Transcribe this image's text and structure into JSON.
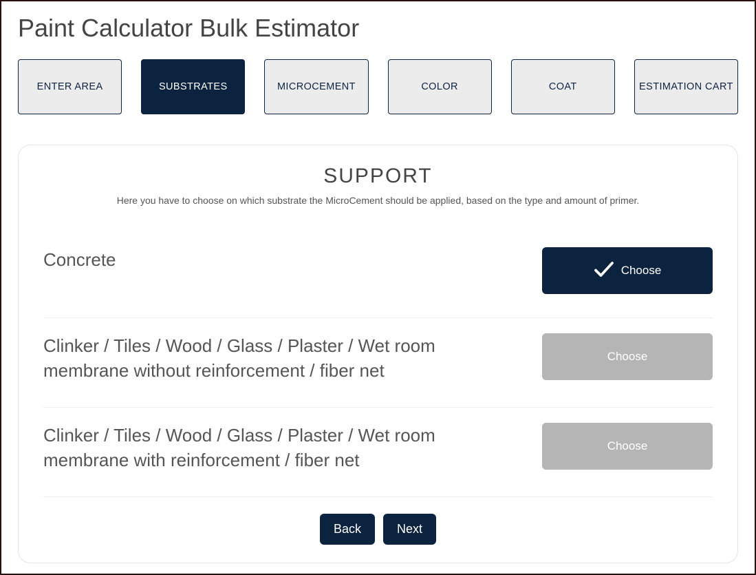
{
  "title": "Paint Calculator Bulk Estimator",
  "tabs": [
    {
      "label": "ENTER AREA",
      "active": false
    },
    {
      "label": "SUBSTRATES",
      "active": true
    },
    {
      "label": "MICROCEMENT",
      "active": false
    },
    {
      "label": "COLOR",
      "active": false
    },
    {
      "label": "COAT",
      "active": false
    },
    {
      "label": "ESTIMATION CART",
      "active": false
    }
  ],
  "panel": {
    "title": "SUPPORT",
    "subtitle": "Here you have to choose on which substrate the MicroCement should be applied, based on the type and amount of primer."
  },
  "options": [
    {
      "label": "Concrete",
      "choose_label": "Choose",
      "selected": true
    },
    {
      "label": "Clinker / Tiles / Wood / Glass / Plaster / Wet room membrane without reinforcement / fiber net",
      "choose_label": "Choose",
      "selected": false
    },
    {
      "label": "Clinker / Tiles / Wood / Glass / Plaster / Wet room membrane with reinforcement / fiber net",
      "choose_label": "Choose",
      "selected": false
    }
  ],
  "nav": {
    "back": "Back",
    "next": "Next"
  }
}
